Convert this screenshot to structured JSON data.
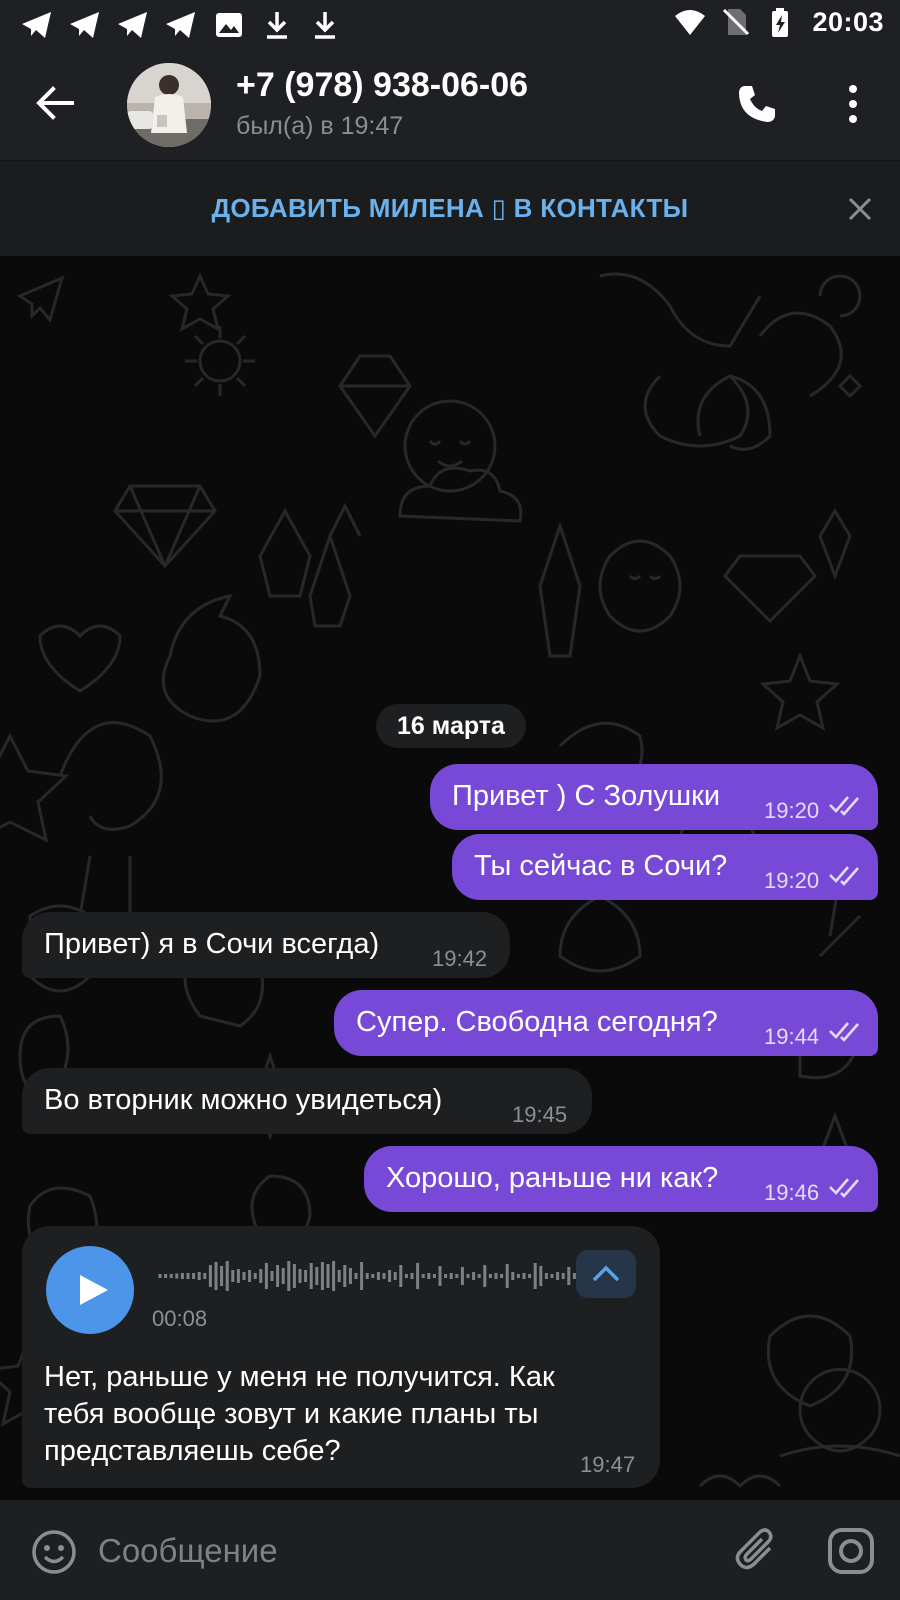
{
  "status_bar": {
    "time": "20:03",
    "notification_icons": [
      "telegram-icon",
      "telegram-icon",
      "telegram-icon",
      "telegram-icon",
      "image-icon",
      "download-icon",
      "download-icon"
    ],
    "system_icons": [
      "wifi-icon",
      "no-sim-icon",
      "battery-charging-icon"
    ]
  },
  "header": {
    "contact_name": "+7 (978) 938-06-06",
    "last_seen": "был(а) в 19:47"
  },
  "add_contact_bar": {
    "label": "ДОБАВИТЬ МИЛЕНА ▯ В КОНТАКТЫ"
  },
  "chat": {
    "date_label": "16 марта",
    "messages": [
      {
        "dir": "out",
        "text": "Привет ) С Золушки",
        "time": "19:20"
      },
      {
        "dir": "out",
        "text": "Ты сейчас в Сочи?",
        "time": "19:20"
      },
      {
        "dir": "in",
        "text": "Привет) я в Сочи всегда)",
        "time": "19:42"
      },
      {
        "dir": "out",
        "text": "Супер. Свободна сегодня?",
        "time": "19:44"
      },
      {
        "dir": "in",
        "text": "Во вторник можно увидеться)",
        "time": "19:45"
      },
      {
        "dir": "out",
        "text": "Хорошо, раньше ни как?",
        "time": "19:46"
      }
    ],
    "voice_message": {
      "duration": "00:08",
      "transcript_lines": [
        "Нет, раньше у меня не получится. Как",
        "тебя вообще зовут и какие планы ты",
        "представляешь себе?"
      ],
      "time": "19:47"
    }
  },
  "input_bar": {
    "placeholder": "Сообщение"
  },
  "colors": {
    "outgoing_bubble": "#7749d6",
    "incoming_bubble": "#1e1f21",
    "accent_blue": "#6cb1ec",
    "play_button": "#4c95e8"
  }
}
